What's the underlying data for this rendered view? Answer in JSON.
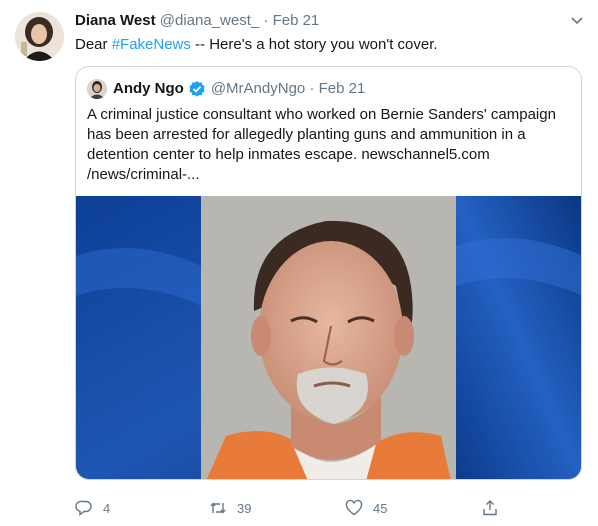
{
  "tweet": {
    "author_name": "Diana West",
    "author_handle": "@diana_west_",
    "separator": "·",
    "date": "Feb 21",
    "text_before": "Dear ",
    "hashtag": "#FakeNews",
    "text_after": " -- Here's a hot story you won't cover."
  },
  "quoted": {
    "author_name": "Andy Ngo",
    "author_handle": "@MrAndyNgo",
    "separator": "·",
    "date": "Feb 21",
    "text": "A criminal justice consultant who worked on Bernie Sanders' campaign has been arrested for allegedly planting guns and ammunition in a detention center to help inmates escape. newschannel5.com /news/criminal-..."
  },
  "actions": {
    "reply_count": "4",
    "retweet_count": "39",
    "like_count": "45"
  },
  "colors": {
    "link": "#1da1f2",
    "muted": "#657786",
    "border": "#ccd6dd"
  }
}
